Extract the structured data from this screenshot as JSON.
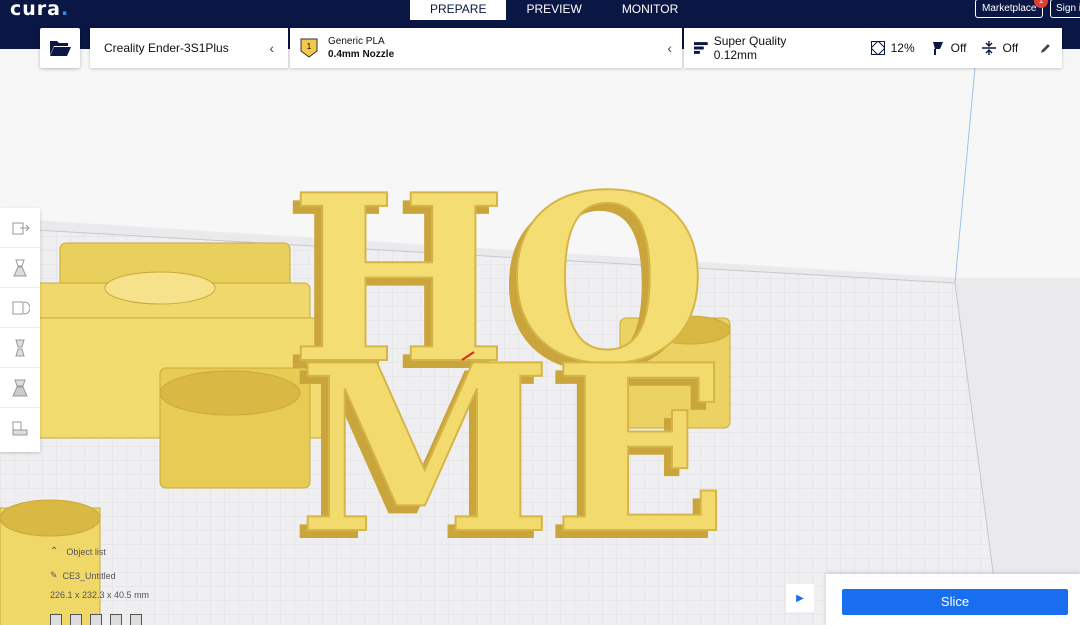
{
  "app": {
    "logo": "cura",
    "logo_dot": "."
  },
  "stages": [
    "PREPARE",
    "PREVIEW",
    "MONITOR"
  ],
  "active_stage": "PREPARE",
  "account": {
    "marketplace_label": "Marketplace",
    "marketplace_badge": "1",
    "signin_label": "Sign in"
  },
  "printer": {
    "name": "Creality Ender-3S1Plus"
  },
  "material": {
    "extruder_number": "1",
    "name": "Generic PLA",
    "nozzle": "0.4mm Nozzle"
  },
  "print_settings": {
    "profile": "Super Quality 0.12mm",
    "infill": "12%",
    "support": "Off",
    "adhesion": "Off"
  },
  "scene": {
    "model_text_top": "HO",
    "model_text_bottom": "ME",
    "model_color": "#f7e27a"
  },
  "object_list": {
    "title": "Object list",
    "object_name": "CE3_Untitled",
    "dimensions": "226.1 x 232.3 x 40.5 mm"
  },
  "slice": {
    "label": "Slice"
  },
  "icons": {
    "open": "folder-open-icon",
    "tools": [
      "move-icon",
      "scale-icon",
      "rotate-icon",
      "mirror-icon",
      "per-model-settings-icon",
      "support-blocker-icon"
    ]
  },
  "colors": {
    "header": "#0a1643",
    "accent": "#196ef0",
    "model": "#f7e27a"
  }
}
